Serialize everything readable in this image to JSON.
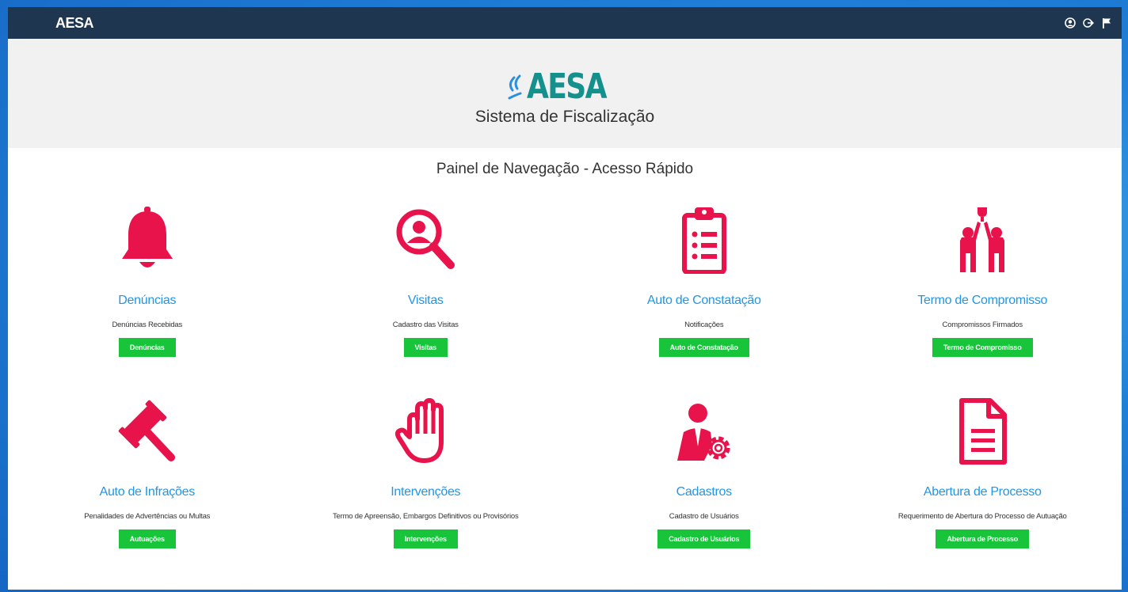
{
  "app": {
    "brand": "AESA"
  },
  "header": {
    "logo_text": "AESA",
    "subtitle": "Sistema de Fiscalização"
  },
  "top_icons": [
    "user-circle-icon",
    "logout-icon",
    "flag-icon"
  ],
  "panel": {
    "title": "Painel de Navegação - Acesso Rápido"
  },
  "colors": {
    "accent_red": "#e8134a",
    "title_blue": "#2196e6",
    "button_green": "#17c43a",
    "topbar": "#1f3650"
  },
  "cards": [
    {
      "icon": "bell-icon",
      "title": "Denúncias",
      "desc": "Denúncias Recebidas",
      "button": "Denúncias"
    },
    {
      "icon": "search-user-icon",
      "title": "Visitas",
      "desc": "Cadastro das Visitas",
      "button": "Visitas"
    },
    {
      "icon": "clipboard-list-icon",
      "title": "Auto de Constatação",
      "desc": "Notificações",
      "button": "Auto de Constatação"
    },
    {
      "icon": "people-trophy-icon",
      "title": "Termo de Compromisso",
      "desc": "Compromissos Firmados",
      "button": "Termo de Compromisso"
    },
    {
      "icon": "gavel-icon",
      "title": "Auto de Infrações",
      "desc": "Penalidades de Advertências ou Multas",
      "button": "Autuações"
    },
    {
      "icon": "hand-icon",
      "title": "Intervenções",
      "desc": "Termo de Apreensão, Embargos Definitivos ou Provisórios",
      "button": "Intervenções"
    },
    {
      "icon": "user-gear-icon",
      "title": "Cadastros",
      "desc": "Cadastro de Usuários",
      "button": "Cadastro de Usuários"
    },
    {
      "icon": "document-icon",
      "title": "Abertura de Processo",
      "desc": "Requerimento de Abertura do Processo de Autuação",
      "button": "Abertura de Processo"
    }
  ]
}
